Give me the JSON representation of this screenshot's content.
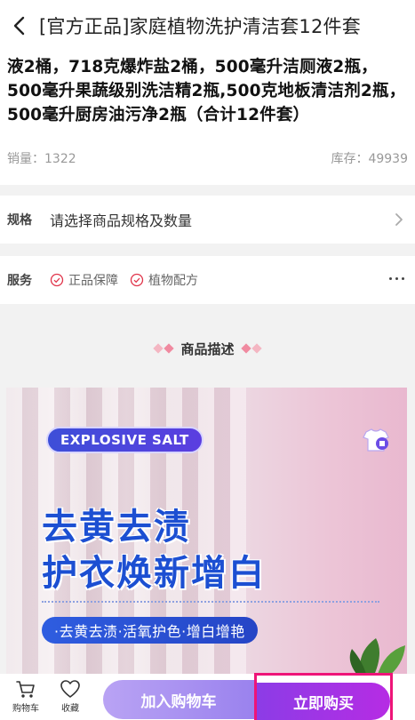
{
  "header": {
    "title": "[官方正品]家庭植物洗护清洁套12件套"
  },
  "product": {
    "title": "液2桶，718克爆炸盐2桶，500毫升洁厕液2瓶，500毫升果蔬级别洗洁精2瓶,500克地板清洁剂2瓶，500毫升厨房油污净2瓶（合计12件套）",
    "sales_label": "销量：",
    "sales_value": "1322",
    "stock_label": "库存：",
    "stock_value": "49939"
  },
  "spec": {
    "label": "规格",
    "value": "请选择商品规格及数量"
  },
  "service": {
    "label": "服务",
    "badges": [
      "正品保障",
      "植物配方"
    ]
  },
  "description": {
    "heading": "商品描述"
  },
  "banner": {
    "pill": "EXPLOSIVE SALT",
    "line1": "去黄去渍",
    "line2": "护衣焕新增白",
    "features": "·去黄去渍·活氧护色·增白增艳"
  },
  "bottom": {
    "cart_label": "购物车",
    "fav_label": "收藏",
    "add_cart": "加入购物车",
    "buy_now": "立即购买"
  },
  "colors": {
    "accent": "#9a3ce6",
    "highlight": "#ee1478",
    "banner_text": "#1c4fd2"
  }
}
